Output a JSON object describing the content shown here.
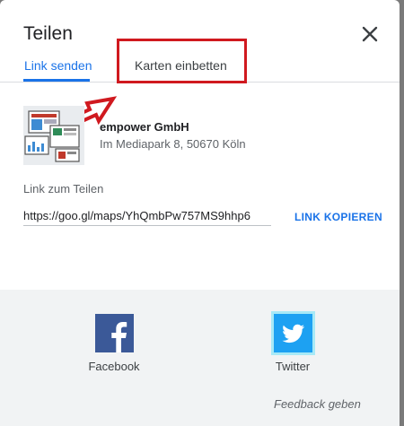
{
  "dialog": {
    "title": "Teilen",
    "close_icon": "close-icon"
  },
  "tabs": [
    {
      "label": "Link senden",
      "active": true
    },
    {
      "label": "Karten einbetten",
      "active": false
    }
  ],
  "place": {
    "name": "empower GmbH",
    "address": "Im Mediapark 8, 50670 Köln"
  },
  "link": {
    "label": "Link zum Teilen",
    "url": "https://goo.gl/maps/YhQmbPw757MS9hhp6",
    "copy_label": "LINK KOPIEREN"
  },
  "social": {
    "facebook": {
      "label": "Facebook",
      "icon": "facebook-icon",
      "color": "#3b5998"
    },
    "twitter": {
      "label": "Twitter",
      "icon": "twitter-icon",
      "color": "#1da1f2"
    }
  },
  "feedback_label": "Feedback geben",
  "colors": {
    "accent": "#1a73e8",
    "annotation": "#d0191f"
  }
}
